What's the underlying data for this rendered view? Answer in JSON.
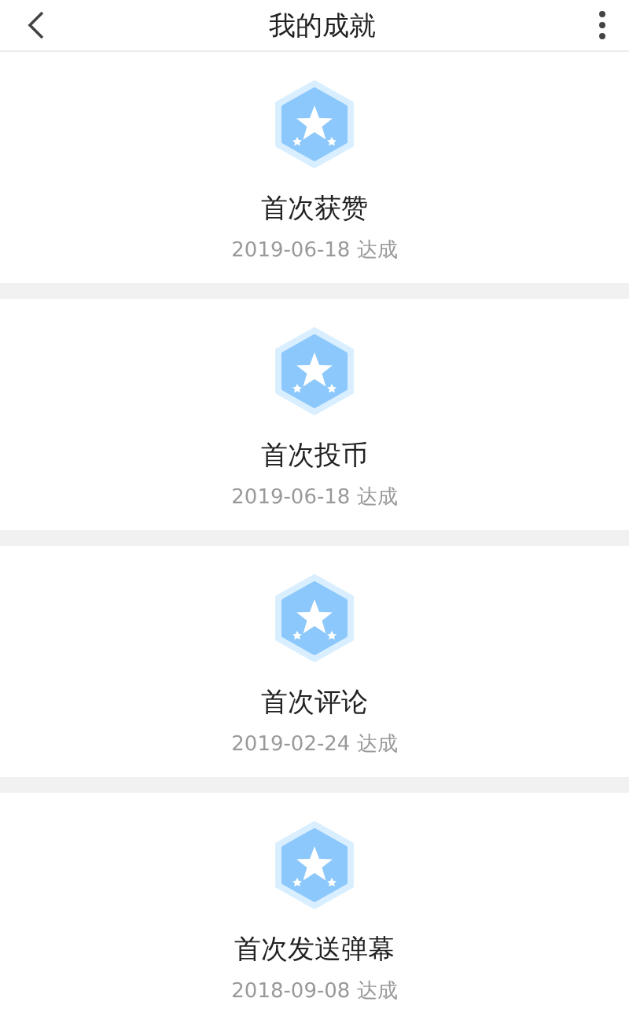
{
  "header": {
    "title": "我的成就"
  },
  "achievements": [
    {
      "name": "首次获赞",
      "date": "2019-06-18 达成"
    },
    {
      "name": "首次投币",
      "date": "2019-06-18 达成"
    },
    {
      "name": "首次评论",
      "date": "2019-02-24 达成"
    },
    {
      "name": "首次发送弹幕",
      "date": "2018-09-08 达成"
    }
  ]
}
